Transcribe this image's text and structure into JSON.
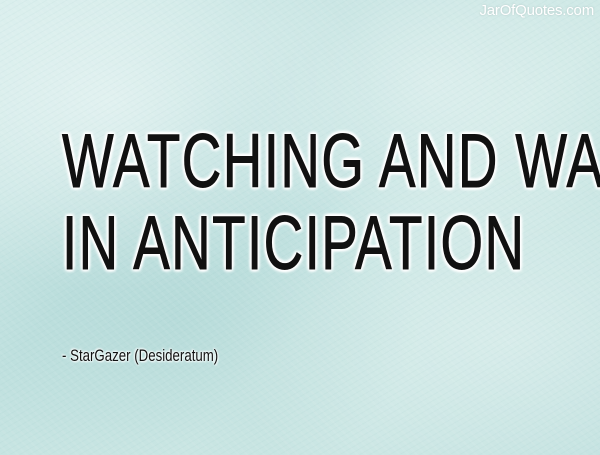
{
  "watermark": "JarOfQuotes.com",
  "quote": {
    "line1": "WATCHING AND WAITING",
    "line2": "IN  ANTICIPATION"
  },
  "attribution": "- StarGazer (Desideratum)",
  "colors": {
    "background": "#c8e5e2",
    "text": "#111111",
    "outline": "#ffffff"
  }
}
